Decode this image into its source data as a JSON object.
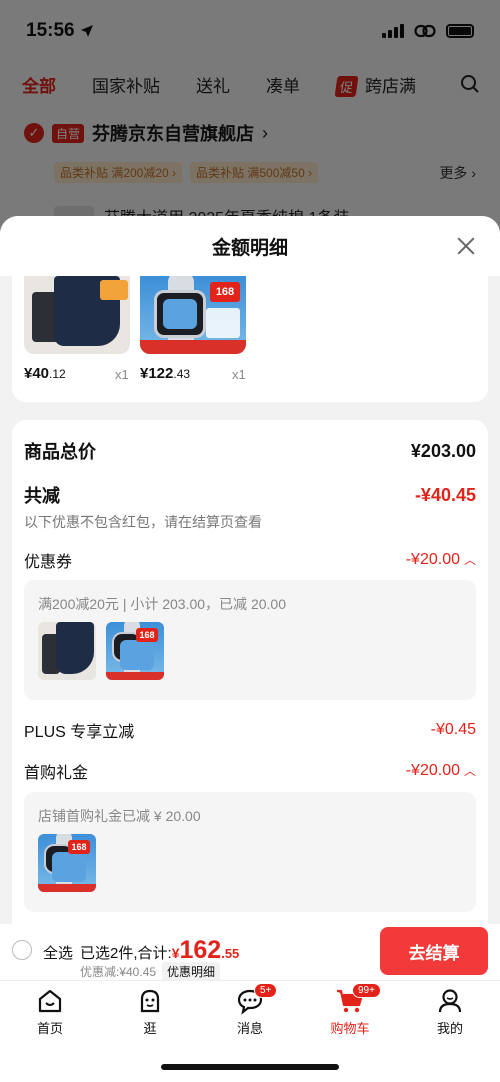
{
  "status": {
    "time": "15:56"
  },
  "top_tabs": {
    "items": [
      "全部",
      "国家补贴",
      "送礼",
      "凑单"
    ],
    "promo_chip": "促",
    "promo_label": "跨店满"
  },
  "shop": {
    "self_badge": "自营",
    "name": "芬腾京东自营旗舰店",
    "chevron": "›",
    "tags": [
      "品类补贴 满200减20 ›",
      "品类补贴 满500减50 ›"
    ],
    "more": "更多 ›"
  },
  "background_peek": {
    "text": "芬腾大道用 2025年夏季纯棉 1条装"
  },
  "sheet": {
    "title": "金额明细"
  },
  "products": [
    {
      "price_int": "¥40",
      "price_dec": ".12",
      "qty": "x1"
    },
    {
      "price_int": "¥122",
      "price_dec": ".43",
      "qty": "x1"
    }
  ],
  "product_image_text": {
    "watch_sticker": "168"
  },
  "details": {
    "total_label": "商品总价",
    "total_value": "¥203.00",
    "reduce_label": "共减",
    "reduce_value": "-¥40.45",
    "reduce_note": "以下优惠不包含红包，请在结算页查看",
    "coupon_label": "优惠券",
    "coupon_value": "-¥20.00",
    "coupon_desc": "满200减20元 | 小计 203.00，已减 20.00",
    "plus_label": "PLUS 专享立减",
    "plus_value": "-¥0.45",
    "gift_label": "首购礼金",
    "gift_value": "-¥20.00",
    "gift_desc": "店铺首购礼金已减 ¥ 20.00"
  },
  "checkout": {
    "select_all": "全选",
    "selected_text": "已选2件,合计:",
    "yen": "¥",
    "total_int": "162",
    "total_dec": ".55",
    "discount_text": "优惠减:¥40.45",
    "detail_button": "优惠明细",
    "submit": "去结算"
  },
  "tabbar": {
    "items": [
      {
        "label": "首页"
      },
      {
        "label": "逛"
      },
      {
        "label": "消息",
        "badge": "5+"
      },
      {
        "label": "购物车",
        "badge": "99+"
      },
      {
        "label": "我的"
      }
    ]
  },
  "colors": {
    "brand_red": "#e2231a",
    "checkout_button": "#f23a3a"
  }
}
